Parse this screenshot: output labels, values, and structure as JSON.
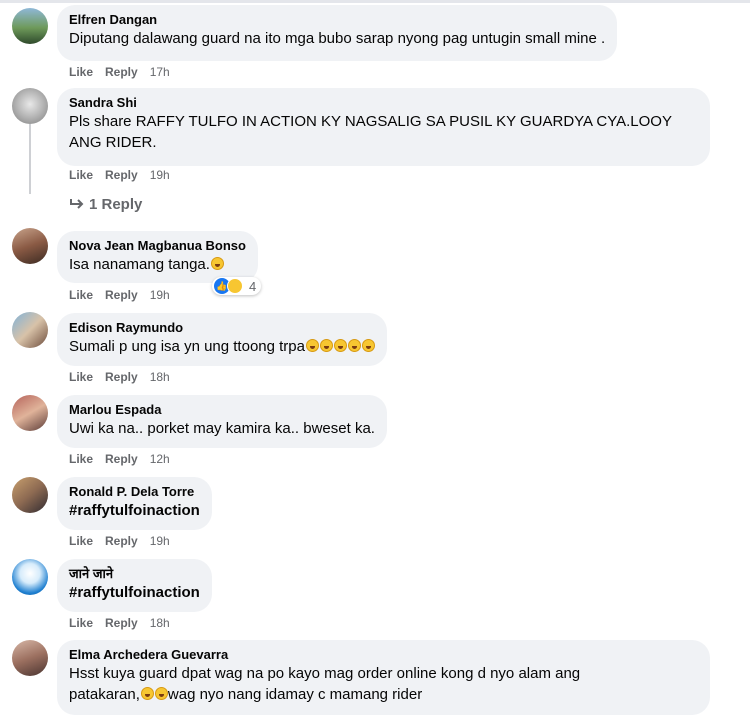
{
  "comments": [
    {
      "author": "Elfren Dangan",
      "text": "Diputang dalawang guard na ito mga bubo sarap nyong pag untugin small mine .",
      "time": "17h"
    },
    {
      "author": "Sandra Shi",
      "text_line1": "Pls share RAFFY TULFO IN ACTION KY NAGSALIG SA PUSIL KY GUARDYA CYA.LOOY",
      "text_line2": "ANG RIDER.",
      "time": "19h",
      "replies_label": "1 Reply"
    },
    {
      "author": "Nova Jean Magbanua Bonso",
      "text": "Isa nanamang tanga.",
      "time": "19h",
      "reaction_count": "4"
    },
    {
      "author": "Edison Raymundo",
      "text": "Sumali p ung isa yn ung ttoong trpa",
      "time": "18h"
    },
    {
      "author": "Marlou Espada",
      "text": "Uwi ka na.. porket may kamira ka.. bweset ka.",
      "time": "12h"
    },
    {
      "author": "Ronald P. Dela Torre",
      "text": "#raffytulfoinaction",
      "time": "19h"
    },
    {
      "author": "जाने जाने",
      "text": "#raffytulfoinaction",
      "time": "18h"
    },
    {
      "author": "Elma Archedera Guevarra",
      "text_line1": "Hsst kuya guard dpat wag na po kayo mag order online kong d nyo alam ang",
      "text_line2_pre": "patakaran,",
      "text_line2_post": "wag nyo nang idamay c mamang rider"
    }
  ],
  "actions": {
    "like": "Like",
    "reply": "Reply"
  },
  "icons": {
    "reply_arrow": "reply-arrow-icon",
    "like_reaction": "like-reaction-icon",
    "haha_reaction": "haha-reaction-icon"
  },
  "colors": {
    "bubble": "#f0f2f5",
    "meta": "#65676b",
    "like_blue": "#1877f2"
  }
}
